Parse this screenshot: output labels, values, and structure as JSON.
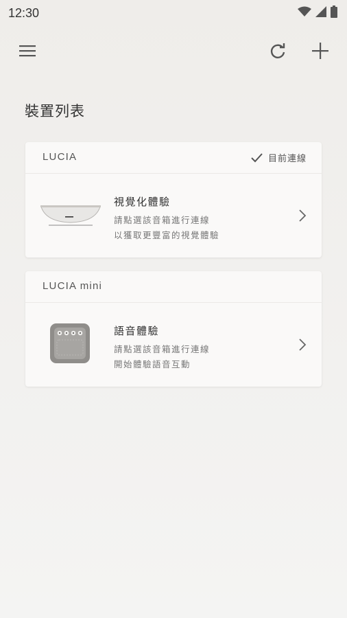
{
  "status_bar": {
    "time": "12:30"
  },
  "page": {
    "title": "裝置列表"
  },
  "devices": [
    {
      "name": "LUCIA",
      "status": "目前連線",
      "feature_title": "視覺化體驗",
      "line1": "請點選該音箱進行連線",
      "line2": "以獲取更豐富的視覺體驗"
    },
    {
      "name": "LUCIA mini",
      "feature_title": "語音體驗",
      "line1": "請點選該音箱進行連線",
      "line2": "開始體驗語音互動"
    }
  ],
  "icons": {
    "menu": "hamburger-menu-icon",
    "refresh": "refresh-icon",
    "add": "plus-icon",
    "check": "check-icon",
    "chevron": "chevron-right-icon"
  },
  "colors": {
    "icon": "#555555",
    "card": "#faf9f8"
  }
}
